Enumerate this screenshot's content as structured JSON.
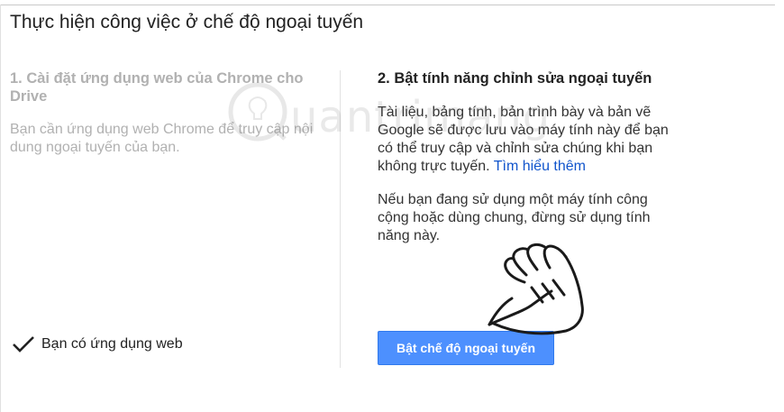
{
  "dialog": {
    "title": "Thực hiện công việc ở chế độ ngoại tuyến"
  },
  "step1": {
    "title": "1. Cài đặt ứng dụng web của Chrome cho Drive",
    "description": "Bạn cần ứng dụng web Chrome để truy cập nội dung ngoại tuyến của bạn.",
    "status_text": "Bạn có ứng dụng web",
    "status_icon": "checkmark-icon"
  },
  "step2": {
    "title": "2. Bật tính năng chỉnh sửa ngoại tuyến",
    "description": "Tài liệu, bảng tính, bản trình bày và bản vẽ Google sẽ được lưu vào máy tính này để bạn có thể truy cập và chỉnh sửa chúng khi bạn không trực tuyến.",
    "learn_more_label": "Tìm hiểu thêm",
    "note": "Nếu bạn đang sử dụng một máy tính công cộng hoặc dùng chung, đừng sử dụng tính năng này.",
    "button_label": "Bật chế độ ngoại tuyến",
    "button_color": "#4d90fe"
  },
  "watermark": {
    "text": "uantrimang"
  }
}
